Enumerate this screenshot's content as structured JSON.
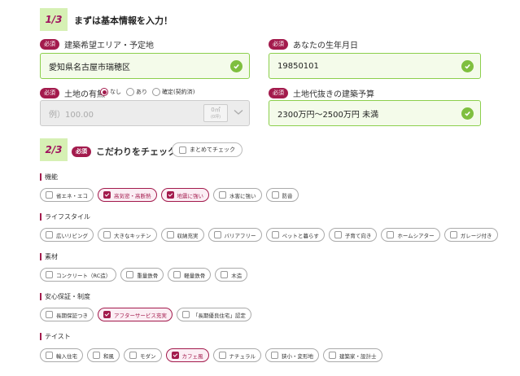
{
  "step1": {
    "badge": "1/3",
    "title": "まずは基本情報を入力！"
  },
  "required_label": "必須",
  "area": {
    "label": "建築希望エリア・予定地",
    "value": "愛知県名古屋市瑞穂区"
  },
  "birth": {
    "label": "あなたの生年月日",
    "value": "19850101"
  },
  "land": {
    "label": "土地の有無",
    "options": [
      "なし",
      "あり",
      "確定(契約済)"
    ],
    "selected": "なし",
    "placeholder": "例）100.00",
    "unit": "0㎡",
    "unit_sub": "(0坪)"
  },
  "budget": {
    "label": "土地代抜きの建築予算",
    "value": "2300万円～2500万円 未満"
  },
  "step2": {
    "badge": "2/3",
    "title": "こだわりをチェック",
    "check_all": "まとめてチェック"
  },
  "categories": [
    {
      "label": "機能",
      "items": [
        {
          "text": "省エネ・エコ",
          "checked": false
        },
        {
          "text": "高気密・高断熱",
          "checked": true
        },
        {
          "text": "地震に強い",
          "checked": true
        },
        {
          "text": "水害に強い",
          "checked": false
        },
        {
          "text": "防音",
          "checked": false
        }
      ]
    },
    {
      "label": "ライフスタイル",
      "items": [
        {
          "text": "広いリビング",
          "checked": false
        },
        {
          "text": "大きなキッチン",
          "checked": false
        },
        {
          "text": "収納充実",
          "checked": false
        },
        {
          "text": "バリアフリー",
          "checked": false
        },
        {
          "text": "ペットと暮らす",
          "checked": false
        },
        {
          "text": "子育て向き",
          "checked": false
        },
        {
          "text": "ホームシアター",
          "checked": false
        },
        {
          "text": "ガレージ付き",
          "checked": false
        }
      ]
    },
    {
      "label": "素材",
      "items": [
        {
          "text": "コンクリート（RC造）",
          "checked": false
        },
        {
          "text": "重量鉄骨",
          "checked": false
        },
        {
          "text": "軽量鉄骨",
          "checked": false
        },
        {
          "text": "木造",
          "checked": false
        }
      ]
    },
    {
      "label": "安心保証・制度",
      "items": [
        {
          "text": "長期保証つき",
          "checked": false
        },
        {
          "text": "アフターサービス充実",
          "checked": true
        },
        {
          "text": "「長期優良住宅」認定",
          "checked": false
        }
      ]
    },
    {
      "label": "テイスト",
      "items": [
        {
          "text": "輸入住宅",
          "checked": false
        },
        {
          "text": "和風",
          "checked": false
        },
        {
          "text": "モダン",
          "checked": false
        },
        {
          "text": "カフェ風",
          "checked": true
        },
        {
          "text": "ナチュラル",
          "checked": false
        },
        {
          "text": "狭小・変形地",
          "checked": false
        },
        {
          "text": "建築家・設計士",
          "checked": false
        }
      ]
    }
  ],
  "colors": {
    "accent": "#a31b4d",
    "valid_border": "#8ccf4d",
    "valid_bg": "#f4fbea",
    "badge_bg": "#d6f0b4",
    "check_green": "#7fbf3f"
  }
}
